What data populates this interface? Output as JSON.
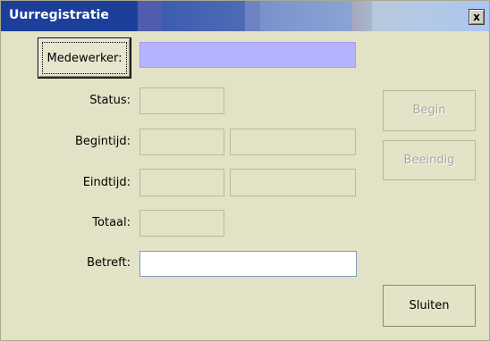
{
  "window": {
    "title": "Uurregistratie",
    "close_label": "x"
  },
  "form": {
    "employee_button": "Medewerker:",
    "employee_value": "",
    "status_label": "Status:",
    "status_value": "",
    "start_label": "Begintijd:",
    "start_date": "",
    "start_time": "",
    "end_label": "Eindtijd:",
    "end_date": "",
    "end_time": "",
    "total_label": "Totaal:",
    "total_value": "",
    "subject_label": "Betreft:",
    "subject_value": ""
  },
  "buttons": {
    "begin": "Begin",
    "end": "Beeindig",
    "close": "Sluiten"
  },
  "colors": {
    "employee_field": "#b3b3ff",
    "window_bg": "#e2e2c6"
  }
}
